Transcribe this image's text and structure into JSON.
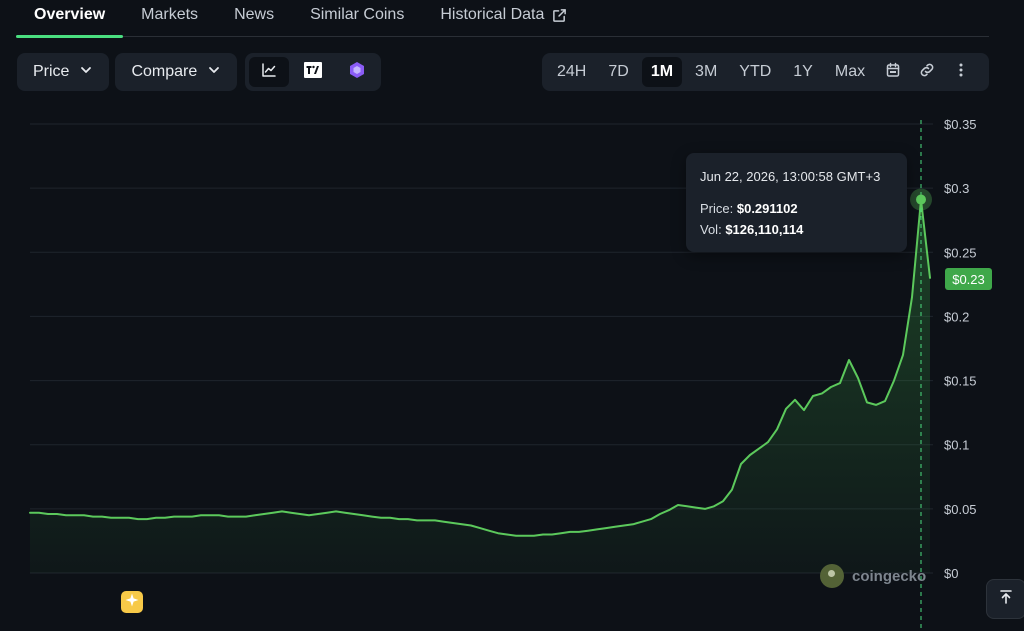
{
  "tabs": [
    {
      "label": "Overview",
      "active": true
    },
    {
      "label": "Markets"
    },
    {
      "label": "News"
    },
    {
      "label": "Similar Coins"
    },
    {
      "label": "Historical Data",
      "icon": "external-link-icon"
    }
  ],
  "toolbar": {
    "price_label": "Price",
    "compare_label": "Compare",
    "chart_types": [
      {
        "icon": "line-chart-icon",
        "active": true
      },
      {
        "icon": "tradingview-icon"
      },
      {
        "icon": "gem-icon"
      }
    ],
    "ranges": [
      "24H",
      "7D",
      "1M",
      "3M",
      "YTD",
      "1Y",
      "Max"
    ],
    "active_range": "1M",
    "extra_icons": [
      "calendar-icon",
      "link-icon",
      "more-vertical-icon"
    ]
  },
  "tooltip": {
    "date": "Jun 22, 2026, 13:00:58 GMT+3",
    "price_label": "Price:",
    "price_value": "$0.291102",
    "vol_label": "Vol:",
    "vol_value": "$126,110,114"
  },
  "current_price_badge": "$0.23",
  "watermark": "coingecko",
  "colors": {
    "accent": "#4ade80",
    "line": "#5cc95c",
    "badge": "#3fa84a",
    "background": "#0d1117",
    "panel": "#1b212a"
  },
  "chart_data": {
    "type": "line",
    "y_ticks": [
      "$0.35",
      "$0.3",
      "$0.25",
      "$0.2",
      "$0.15",
      "$0.1",
      "$0.05",
      "$0"
    ],
    "ylim": [
      0,
      0.35
    ],
    "grid": true,
    "series": [
      {
        "x": [
          0,
          0.01,
          0.02,
          0.03,
          0.04,
          0.05,
          0.06,
          0.07,
          0.08,
          0.09,
          0.1,
          0.11,
          0.12,
          0.13,
          0.14,
          0.15,
          0.16,
          0.17,
          0.18,
          0.19,
          0.2,
          0.21,
          0.22,
          0.23,
          0.24,
          0.25,
          0.26,
          0.27,
          0.28,
          0.29,
          0.3,
          0.31,
          0.32,
          0.33,
          0.34,
          0.35,
          0.36,
          0.37,
          0.38,
          0.39,
          0.4,
          0.41,
          0.42,
          0.43,
          0.44,
          0.45,
          0.46,
          0.47,
          0.48,
          0.49,
          0.5,
          0.51,
          0.52,
          0.53,
          0.54,
          0.55,
          0.56,
          0.57,
          0.58,
          0.59,
          0.6,
          0.61,
          0.62,
          0.63,
          0.64,
          0.65,
          0.66,
          0.67,
          0.68,
          0.69,
          0.7,
          0.71,
          0.72,
          0.73,
          0.74,
          0.75,
          0.76,
          0.77,
          0.78,
          0.79,
          0.8,
          0.81,
          0.82,
          0.83,
          0.84,
          0.85,
          0.86,
          0.87,
          0.88,
          0.89,
          0.9,
          0.91,
          0.92,
          0.93,
          0.94,
          0.95,
          0.96,
          0.97,
          0.98,
          0.99,
          1.0
        ],
        "values": [
          0.047,
          0.047,
          0.046,
          0.046,
          0.045,
          0.045,
          0.045,
          0.044,
          0.044,
          0.043,
          0.043,
          0.043,
          0.042,
          0.042,
          0.043,
          0.043,
          0.044,
          0.044,
          0.044,
          0.045,
          0.045,
          0.045,
          0.044,
          0.044,
          0.044,
          0.045,
          0.046,
          0.047,
          0.048,
          0.047,
          0.046,
          0.045,
          0.046,
          0.047,
          0.048,
          0.047,
          0.046,
          0.045,
          0.044,
          0.043,
          0.043,
          0.042,
          0.042,
          0.041,
          0.041,
          0.041,
          0.04,
          0.039,
          0.038,
          0.037,
          0.035,
          0.033,
          0.031,
          0.03,
          0.029,
          0.029,
          0.029,
          0.03,
          0.03,
          0.031,
          0.032,
          0.032,
          0.033,
          0.034,
          0.035,
          0.036,
          0.037,
          0.038,
          0.04,
          0.042,
          0.046,
          0.049,
          0.053,
          0.052,
          0.051,
          0.05,
          0.052,
          0.056,
          0.065,
          0.085,
          0.092,
          0.097,
          0.102,
          0.112,
          0.128,
          0.135,
          0.127,
          0.138,
          0.14,
          0.145,
          0.148,
          0.166,
          0.152,
          0.133,
          0.131,
          0.134,
          0.15,
          0.17,
          0.215,
          0.291,
          0.23
        ]
      }
    ],
    "hover_point": {
      "price": 0.291102
    },
    "current_price": 0.23
  }
}
